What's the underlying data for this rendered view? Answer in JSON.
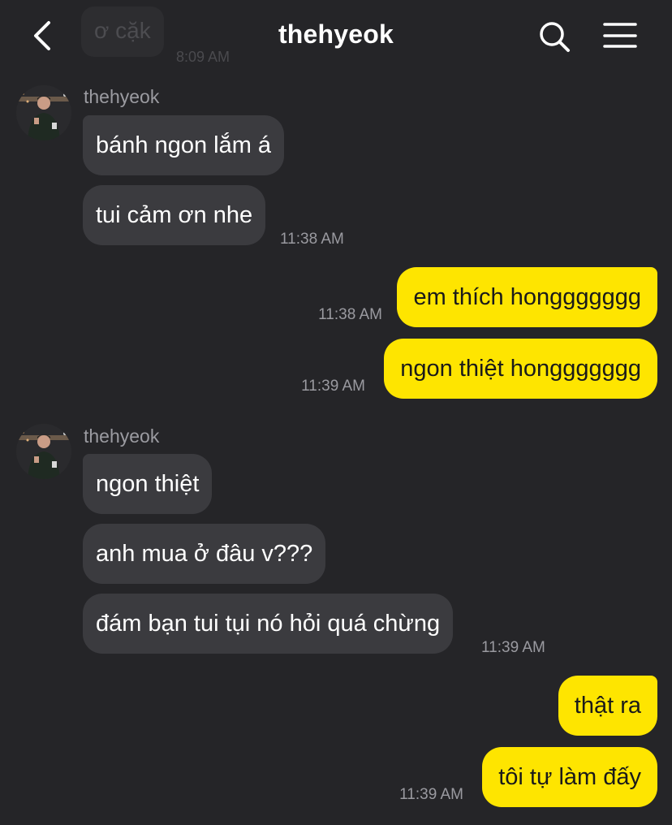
{
  "header": {
    "title": "thehyeok",
    "icons": {
      "back": "chevron-left-icon",
      "search": "search-icon",
      "menu": "hamburger-menu-icon"
    }
  },
  "previous": {
    "text": "ơ cặk",
    "time": "8:09 AM"
  },
  "groups": [
    {
      "sender": "thehyeok",
      "messages": [
        {
          "text": "bánh ngon lắm á"
        },
        {
          "text": "tui cảm ơn nhe",
          "time": "11:38 AM"
        }
      ]
    },
    {
      "sender": "me",
      "messages": [
        {
          "text": "em thích honggggggg",
          "time": "11:38 AM"
        },
        {
          "text": "ngon thiệt honggggggg",
          "time": "11:39 AM"
        }
      ]
    },
    {
      "sender": "thehyeok",
      "messages": [
        {
          "text": "ngon thiệt"
        },
        {
          "text": "anh mua ở đâu v???"
        },
        {
          "text": "đám bạn tui tụi nó hỏi quá chừng",
          "time": "11:39 AM"
        }
      ]
    },
    {
      "sender": "me",
      "messages": [
        {
          "text": "thật ra"
        },
        {
          "text": "tôi tự làm đấy",
          "time": "11:39 AM"
        }
      ]
    }
  ],
  "colors": {
    "background": "#252528",
    "incoming_bubble": "#3b3b3f",
    "outgoing_bubble": "#fee500",
    "outgoing_text": "#1a1a1a",
    "timestamp": "#9a9aa0"
  }
}
